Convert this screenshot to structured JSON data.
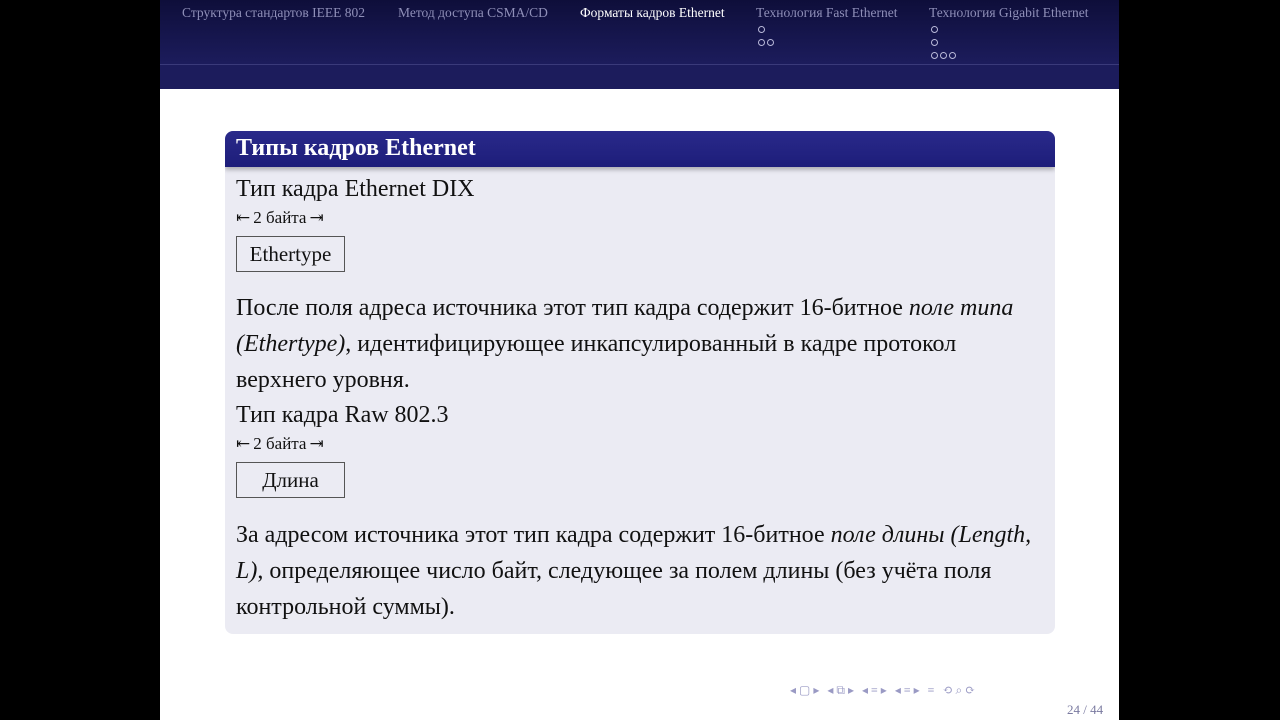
{
  "nav": {
    "sections": [
      {
        "label": "Структура стандартов IEEE 802"
      },
      {
        "label": "Метод доступа CSMA/CD"
      },
      {
        "label": "Форматы кадров Ethernet"
      },
      {
        "label": "Технология Fast Ethernet"
      },
      {
        "label": "Технология Gigabit Ethernet"
      }
    ]
  },
  "block": {
    "title": "Типы кадров Ethernet",
    "items": [
      {
        "heading": "Тип кадра Ethernet DIX",
        "size_label": "2 байта",
        "field": "Ethertype",
        "text_before": "После поля адреса источника этот тип кадра содержит 16-битное ",
        "text_em": "поле типа (Ethertype)",
        "text_after": ", идентифицирующее инкапсулированный в кадре протокол верхнего уровня."
      },
      {
        "heading": "Тип кадра Raw 802.3",
        "size_label": "2 байта",
        "field": "Длина",
        "text_before": "За адресом источника этот тип кадра содержит 16-битное ",
        "text_em": "поле длины (Length, L)",
        "text_after": ", определяющее число байт, следующее за полем длины (без учёта поля контрольной суммы)."
      }
    ]
  },
  "footer": {
    "page": "24 / 44"
  }
}
